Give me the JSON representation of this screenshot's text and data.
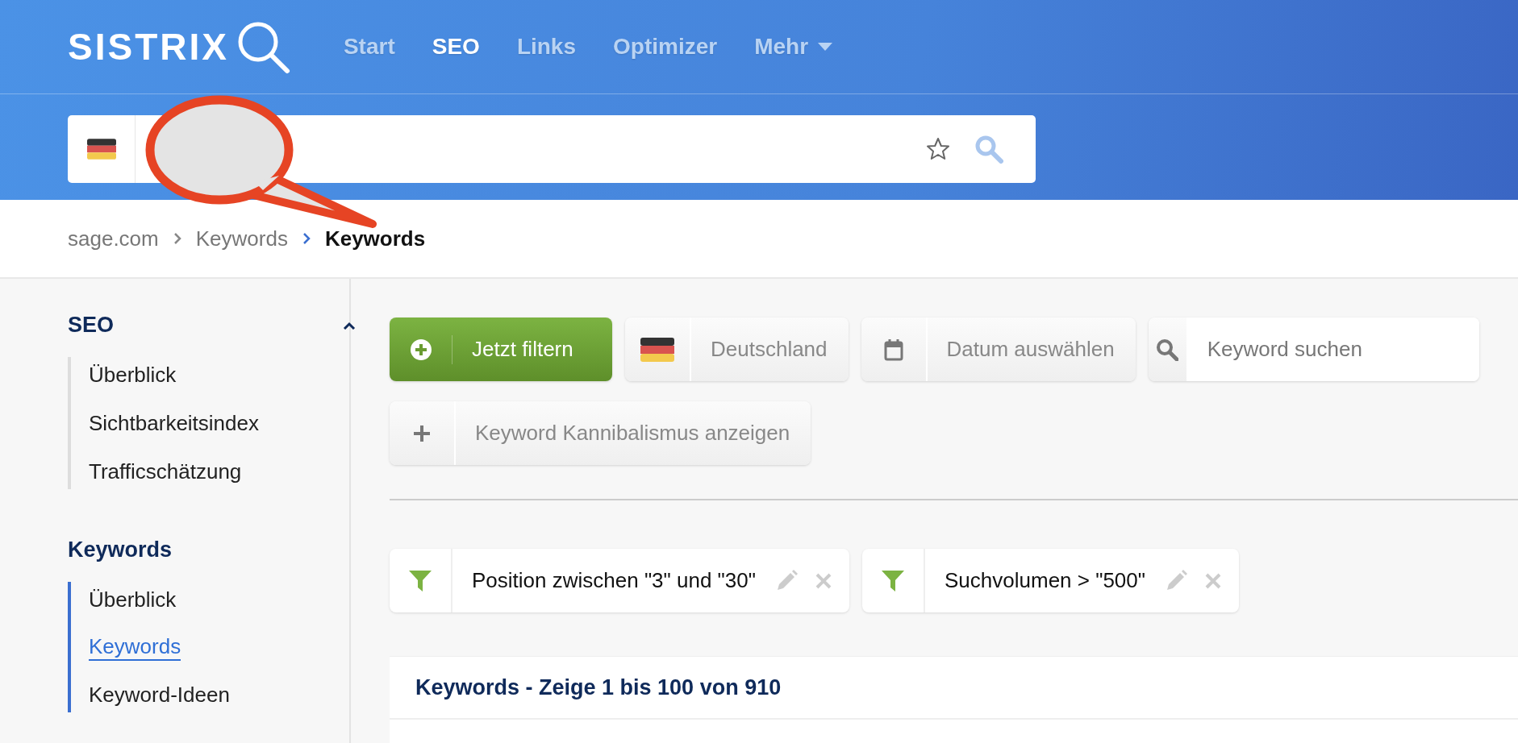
{
  "header": {
    "logo": "SISTRIX",
    "nav": [
      {
        "label": "Start",
        "selected": false,
        "dropdown": false
      },
      {
        "label": "SEO",
        "selected": true,
        "dropdown": false
      },
      {
        "label": "Links",
        "selected": false,
        "dropdown": false
      },
      {
        "label": "Optimizer",
        "selected": false,
        "dropdown": false
      },
      {
        "label": "Mehr",
        "selected": false,
        "dropdown": true
      }
    ]
  },
  "search_bar": {
    "favorite": false
  },
  "breadcrumb": [
    {
      "label": "sage.com",
      "current": false
    },
    {
      "label": "Keywords",
      "current": false
    },
    {
      "label": "Keywords",
      "current": true
    }
  ],
  "sidebar": {
    "sections": [
      {
        "title": "SEO",
        "expanded": true,
        "items": [
          {
            "label": "Überblick",
            "selected": false
          },
          {
            "label": "Sichtbarkeitsindex",
            "selected": false
          },
          {
            "label": "Trafficschätzung",
            "selected": false
          }
        ]
      },
      {
        "title": "Keywords",
        "items": [
          {
            "label": "Überblick",
            "selected": false
          },
          {
            "label": "Keywords",
            "selected": true
          },
          {
            "label": "Keyword-Ideen",
            "selected": false
          }
        ]
      }
    ]
  },
  "toolbar": {
    "rows": [
      [
        {
          "kind": "primary",
          "label": "Jetzt filtern"
        },
        {
          "kind": "country",
          "label": "Deutschland"
        },
        {
          "kind": "date",
          "label": "Datum auswählen"
        },
        {
          "kind": "search",
          "placeholder": "Keyword suchen"
        }
      ],
      [
        {
          "kind": "toggle",
          "label": "Keyword Kannibalismus anzeigen"
        }
      ]
    ]
  },
  "filters": [
    {
      "label": "Position zwischen \"3\" und \"30\""
    },
    {
      "label": "Suchvolumen > \"500\""
    }
  ],
  "card": {
    "title": "Keywords - Zeige 1 bis 100 von 910"
  }
}
